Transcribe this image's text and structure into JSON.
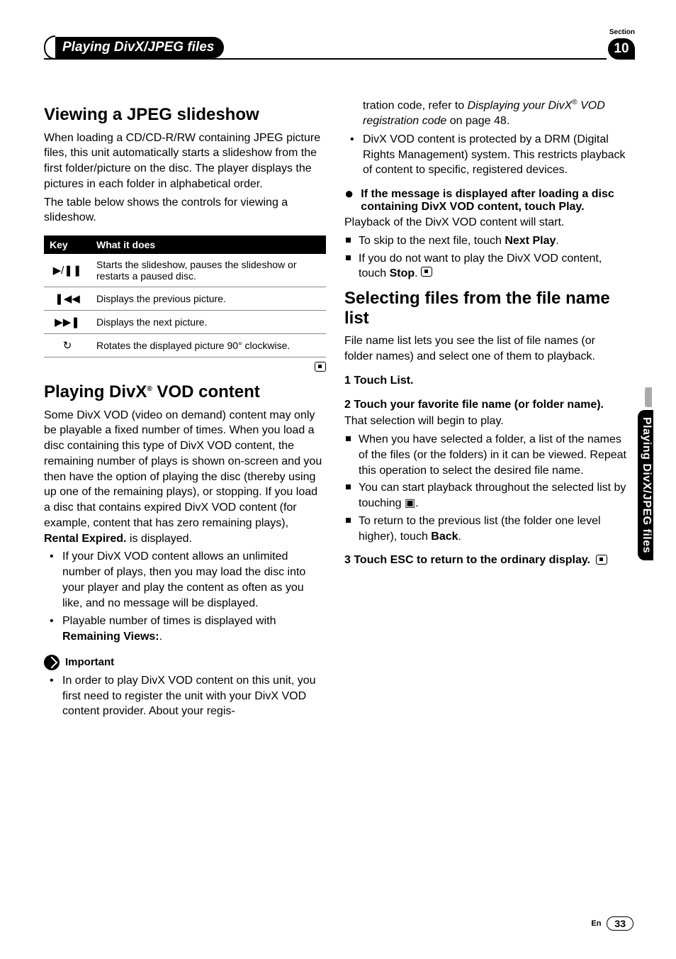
{
  "chapter_title": "Playing DivX/JPEG files",
  "section_label": "Section",
  "section_number": "10",
  "side_tab": "Playing DivX/JPEG files",
  "footer": {
    "lang": "En",
    "page": "33"
  },
  "left": {
    "h1": "Viewing a JPEG slideshow",
    "p1": "When loading a CD/CD-R/RW containing JPEG picture files, this unit automatically starts a slideshow from the first folder/picture on the disc. The player displays the pictures in each folder in alphabetical order.",
    "p2": "The table below shows the controls for viewing a slideshow.",
    "table": {
      "head": [
        "Key",
        "What it does"
      ],
      "rows": [
        {
          "key": "▶/❚❚",
          "desc": "Starts the slideshow, pauses the slideshow or restarts a paused disc."
        },
        {
          "key": "❚◀◀",
          "desc": "Displays the previous picture."
        },
        {
          "key": "▶▶❚",
          "desc": "Displays the next picture."
        },
        {
          "key": "↻",
          "desc": "Rotates the displayed picture 90° clockwise."
        }
      ]
    },
    "h2_pre": "Playing DivX",
    "h2_sup": "®",
    "h2_post": " VOD content",
    "p3a": "Some DivX VOD (video on demand) content may only be playable a fixed number of times. When you load a disc containing this type of DivX VOD content, the remaining number of plays is shown on-screen and you then have the option of playing the disc (thereby using up one of the remaining plays), or stopping. If you load a disc that contains expired DivX VOD content (for example, content that has zero remaining plays), ",
    "p3b": "Rental Expired.",
    "p3c": " is displayed.",
    "bul1": "If your DivX VOD content allows an unlimited number of plays, then you may load the disc into your player and play the content as often as you like, and no message will be displayed.",
    "bul2a": "Playable number of times is displayed with ",
    "bul2b": "Remaining Views:",
    "bul2c": ".",
    "important": "Important",
    "imp1": "In order to play DivX VOD content on this unit, you first need to register the unit with your DivX VOD content provider. About your regis-"
  },
  "right": {
    "cont1a": "tration code, refer to ",
    "cont1b": "Displaying your DivX",
    "cont1sup": "®",
    "cont1c": " VOD registration code",
    "cont1d": " on page 48.",
    "bul_r1": "DivX VOD content is protected by a DRM (Digital Rights Management) system. This restricts playback of content to specific, registered devices.",
    "lead": "If the message is displayed after loading a disc containing DivX VOD content, touch Play.",
    "p_r1": "Playback of the DivX VOD content will start.",
    "sq1a": "To skip to the next file, touch ",
    "sq1b": "Next Play",
    "sq1c": ".",
    "sq2a": "If you do not want to play the DivX VOD content, touch ",
    "sq2b": "Stop",
    "sq2c": ".",
    "h3": "Selecting files from the file name list",
    "p_r2": "File name list lets you see the list of file names (or folder names) and select one of them to playback.",
    "step1": "1    Touch List.",
    "step2": "2    Touch your favorite file name (or folder name).",
    "p_r3": "That selection will begin to play.",
    "sq3": "When you have selected a folder, a list of the names of the files (or the folders) in it can be viewed. Repeat this operation to select the desired file name.",
    "sq4": "You can start playback throughout the selected list by touching ",
    "sq4b": ".",
    "sq5a": "To return to the previous list (the folder one level higher), touch ",
    "sq5b": "Back",
    "sq5c": ".",
    "step3a": "3    Touch ESC to return to the ordinary display.",
    "playall_icon": "▣"
  }
}
